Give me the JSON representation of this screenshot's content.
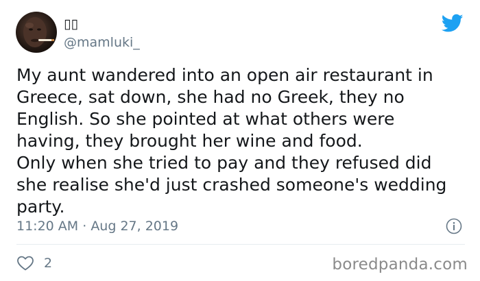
{
  "tweet": {
    "display_name": "▯▯",
    "handle": "@mamluki_",
    "text": "My aunt wandered into an open air restaurant in\nGreece, sat down, she had no Greek, they no\nEnglish. So she pointed at what others were\nhaving, they brought her wine and food.\nOnly when she tried to pay and they refused did\nshe realise she'd just crashed someone's wedding\nparty.",
    "time": "11:20 AM",
    "separator": " · ",
    "date": "Aug 27, 2019",
    "like_count": "2"
  },
  "icons": {
    "brand": "twitter-bird-icon",
    "info": "info-icon",
    "like": "heart-icon"
  },
  "colors": {
    "twitter_blue": "#1da1f2",
    "secondary_text": "#657786",
    "divider": "#e6ecf0"
  },
  "watermark": {
    "text": "boredpanda.com"
  }
}
